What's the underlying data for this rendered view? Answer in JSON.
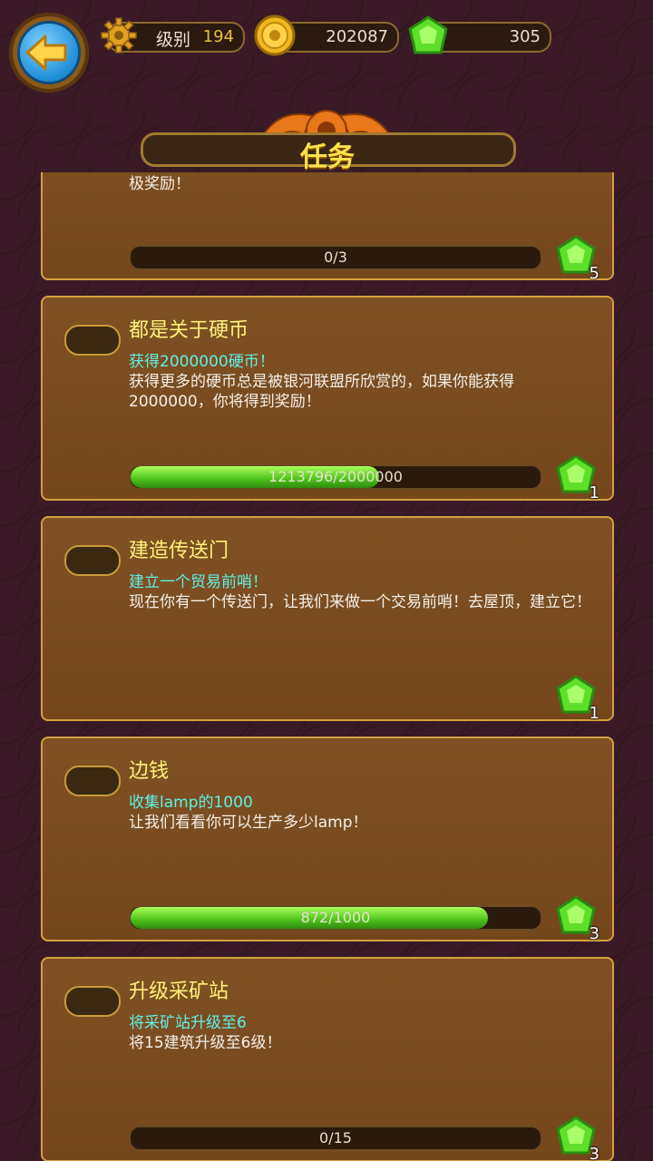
{
  "header": {
    "level_label": "级别",
    "level_value": "194",
    "coins": "202087",
    "gems": "305",
    "title": "任务"
  },
  "quests": [
    {
      "name": "",
      "subtitle": "",
      "description": "极奖励！",
      "progress_text": "0/3",
      "progress": 0.0,
      "reward": "5"
    },
    {
      "name": "都是关于硬币",
      "subtitle": "获得2000000硬币！",
      "description": "获得更多的硬币总是被银河联盟所欣赏的，如果你能获得2000000，你将得到奖励！",
      "progress_text": "1213796/2000000",
      "progress": 0.607,
      "reward": "1"
    },
    {
      "name": "建造传送门",
      "subtitle": "建立一个贸易前哨！",
      "description": "现在你有一个传送门，让我们来做一个交易前哨！去屋顶，建立它！",
      "progress_text": "",
      "progress": null,
      "reward": "1"
    },
    {
      "name": "边钱",
      "subtitle": "收集lamp的1000",
      "description": "让我们看看你可以生产多少lamp！",
      "progress_text": "872/1000",
      "progress": 0.872,
      "reward": "3"
    },
    {
      "name": "升级采矿站",
      "subtitle": "将采矿站升级至6",
      "description": "将15建筑升级至6级！",
      "progress_text": "0/15",
      "progress": 0.0,
      "reward": "3"
    }
  ]
}
